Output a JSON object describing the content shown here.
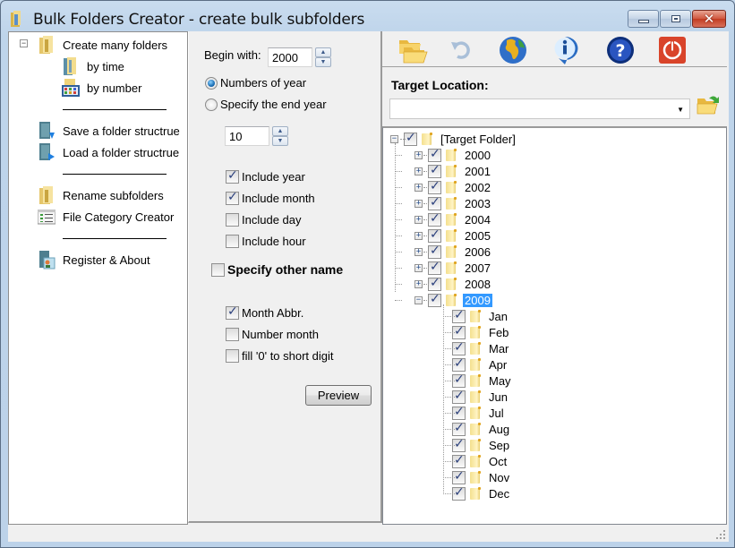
{
  "window": {
    "title": "Bulk Folders Creator - create bulk subfolders",
    "controls": {
      "minimize": "minimize",
      "maximize": "maximize",
      "close": "✕"
    }
  },
  "nav": {
    "items": [
      {
        "label": "Create many folders",
        "icon": "folder-stack-icon",
        "expanded": true
      },
      {
        "label": "by time",
        "icon": "folder-time-icon"
      },
      {
        "label": "by number",
        "icon": "folder-number-icon"
      },
      {
        "label": "Save a folder structrue",
        "icon": "save-structure-icon"
      },
      {
        "label": "Load a folder structrue",
        "icon": "load-structure-icon"
      },
      {
        "label": "Rename subfolders",
        "icon": "rename-folder-icon"
      },
      {
        "label": "File Category Creator",
        "icon": "category-list-icon"
      },
      {
        "label": "Register & About",
        "icon": "register-about-icon"
      }
    ],
    "expander": "−"
  },
  "options": {
    "begin_with_label": "Begin with:",
    "begin_with_value": "2000",
    "radio_numbers_of_year": {
      "label": "Numbers of year",
      "selected": true
    },
    "radio_specify_end_year": {
      "label": "Specify the end year",
      "selected": false
    },
    "count_value": "10",
    "include_year": {
      "label": "Include year",
      "checked": true
    },
    "include_month": {
      "label": "Include month",
      "checked": true
    },
    "include_day": {
      "label": "Include day",
      "checked": false
    },
    "include_hour": {
      "label": "Include hour",
      "checked": false
    },
    "specify_other_name": {
      "label": "Specify other name",
      "checked": false
    },
    "month_abbr": {
      "label": "Month Abbr.",
      "checked": true
    },
    "number_month": {
      "label": "Number month",
      "checked": false
    },
    "fill_zero": {
      "label": "fill '0' to short  digit",
      "checked": false
    },
    "preview_label": "Preview",
    "spin_up": "▲",
    "spin_down": "▼"
  },
  "toolbar": {
    "buttons": [
      "open-folders-icon",
      "undo-icon",
      "globe-icon",
      "info-icon",
      "help-icon",
      "power-icon"
    ]
  },
  "target": {
    "label": "Target Location:",
    "value": "",
    "dropdown_arrow": "▼"
  },
  "tree": {
    "root": {
      "label": "[Target Folder]",
      "checked": true,
      "expanded": true
    },
    "years": [
      {
        "label": "2000",
        "checked": true,
        "expanded": false
      },
      {
        "label": "2001",
        "checked": true,
        "expanded": false
      },
      {
        "label": "2002",
        "checked": true,
        "expanded": false
      },
      {
        "label": "2003",
        "checked": true,
        "expanded": false
      },
      {
        "label": "2004",
        "checked": true,
        "expanded": false
      },
      {
        "label": "2005",
        "checked": true,
        "expanded": false
      },
      {
        "label": "2006",
        "checked": true,
        "expanded": false
      },
      {
        "label": "2007",
        "checked": true,
        "expanded": false
      },
      {
        "label": "2008",
        "checked": true,
        "expanded": false
      },
      {
        "label": "2009",
        "checked": true,
        "expanded": true,
        "selected": true
      }
    ],
    "months": [
      "Jan",
      "Feb",
      "Mar",
      "Apr",
      "May",
      "Jun",
      "Jul",
      "Aug",
      "Sep",
      "Oct",
      "Nov",
      "Dec"
    ],
    "plus": "+",
    "minus": "−"
  }
}
